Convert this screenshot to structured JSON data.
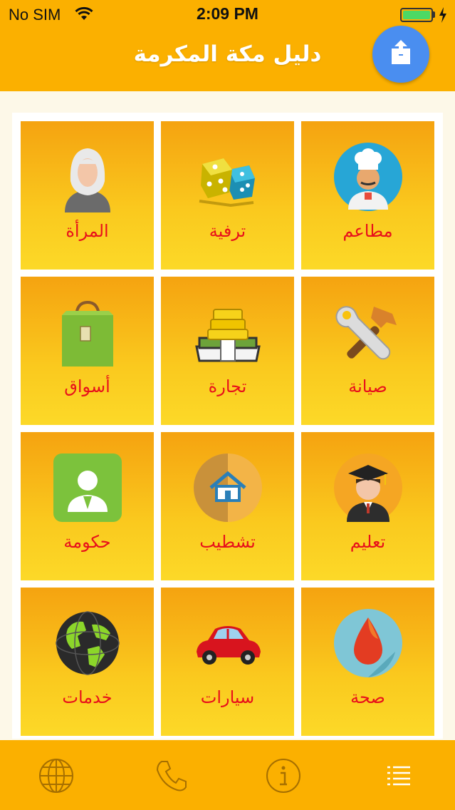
{
  "status_bar": {
    "carrier": "No SIM",
    "time": "2:09 PM",
    "battery_level": 1.0
  },
  "header": {
    "title": "دليل مكة المكرمة",
    "share_icon": "share-icon"
  },
  "categories": [
    {
      "label": "مطاعم",
      "icon": "chef-icon"
    },
    {
      "label": "ترفية",
      "icon": "dice-icon"
    },
    {
      "label": "المرأة",
      "icon": "woman-icon"
    },
    {
      "label": "صيانة",
      "icon": "tools-icon"
    },
    {
      "label": "تجارة",
      "icon": "money-icon"
    },
    {
      "label": "أسواق",
      "icon": "shopping-bag-icon"
    },
    {
      "label": "تعليم",
      "icon": "graduate-icon"
    },
    {
      "label": "تشطيب",
      "icon": "house-icon"
    },
    {
      "label": "حكومة",
      "icon": "official-icon"
    },
    {
      "label": "صحة",
      "icon": "blood-drop-icon"
    },
    {
      "label": "سيارات",
      "icon": "car-icon"
    },
    {
      "label": "خدمات",
      "icon": "globe-icon"
    }
  ],
  "tab_bar": {
    "items": [
      {
        "icon": "globe-tab-icon"
      },
      {
        "icon": "phone-icon"
      },
      {
        "icon": "info-icon"
      },
      {
        "icon": "list-icon"
      }
    ]
  },
  "colors": {
    "header": "#fbb000",
    "tile_top": "#f5a310",
    "tile_bottom": "#fcd928",
    "label": "#e8101b",
    "share_button": "#4a8ef0"
  }
}
